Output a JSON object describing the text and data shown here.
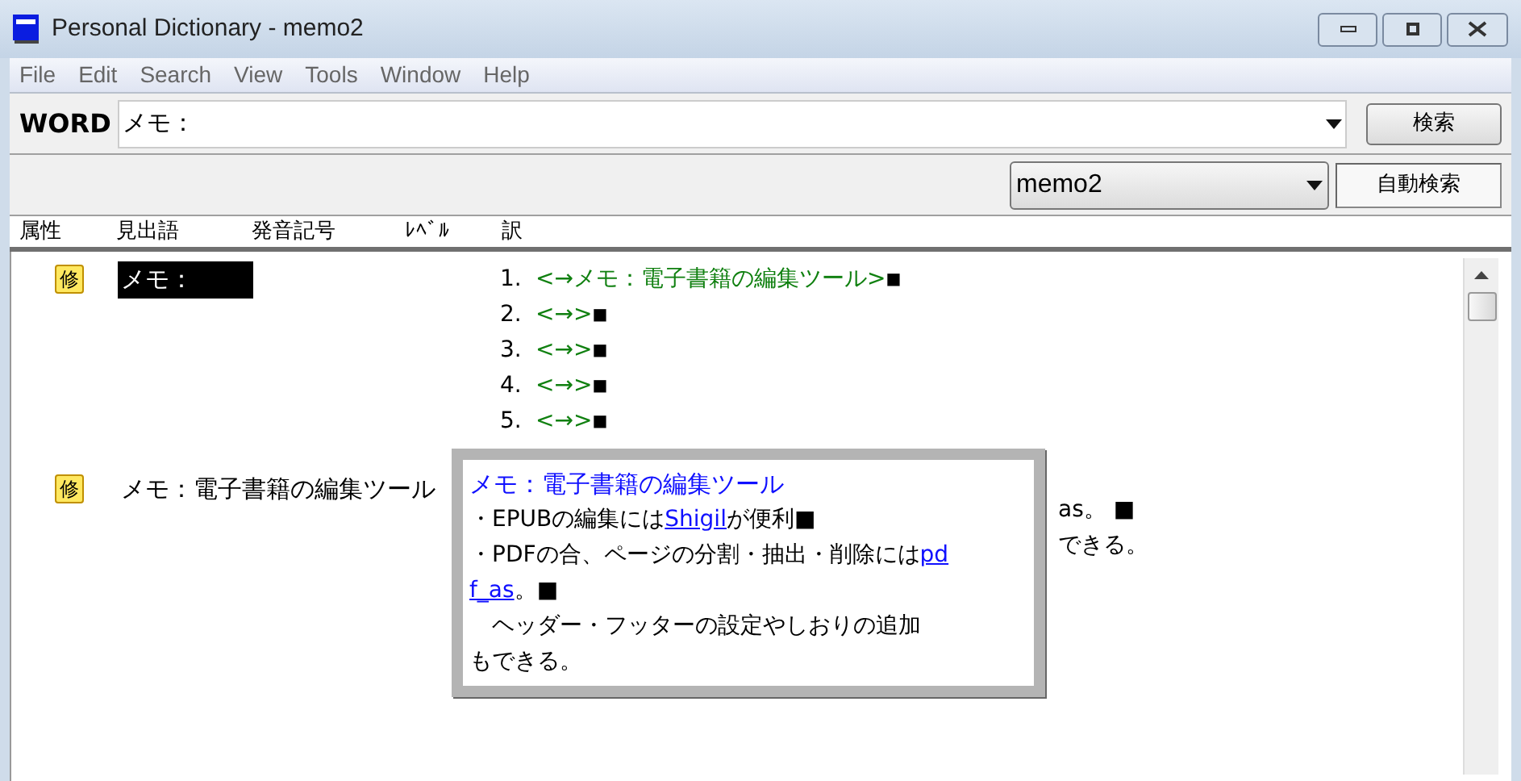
{
  "window": {
    "title": "Personal Dictionary - memo2"
  },
  "menu": [
    "File",
    "Edit",
    "Search",
    "View",
    "Tools",
    "Window",
    "Help"
  ],
  "search": {
    "label": "WORD",
    "value": "メモ：",
    "button": "検索"
  },
  "dictionary": {
    "value": "memo2",
    "button": "自動検索",
    "pressed": false
  },
  "columns": [
    "属性",
    "見出語",
    "発音記号",
    "ﾚﾍﾞﾙ",
    "訳"
  ],
  "entries": [
    {
      "badge": "修",
      "headword": "メモ：",
      "selected": true,
      "senses": [
        {
          "number": "1.",
          "text": "<→メモ：電子書籍の編集ツール>",
          "end": "■"
        },
        {
          "number": "2.",
          "text": "<→>",
          "end": "■"
        },
        {
          "number": "3.",
          "text": "<→>",
          "end": "■"
        },
        {
          "number": "4.",
          "text": "<→>",
          "end": "■"
        },
        {
          "number": "5.",
          "text": "<→>",
          "end": "■"
        }
      ]
    },
    {
      "badge": "修",
      "headword": "メモ：電子書籍の編集ツール",
      "selected": false,
      "fragments": [
        "as。 ■",
        "できる。"
      ]
    }
  ],
  "popup": {
    "title": "メモ：電子書籍の編集ツール",
    "lines": [
      {
        "kind": "text",
        "parts": [
          {
            "text": "・EPUBの編集には"
          },
          {
            "text": "Shigil",
            "link": true
          },
          {
            "text": "が便利■"
          }
        ]
      },
      {
        "kind": "text",
        "parts": [
          {
            "text": "・PDFの合、ページの分割・抽出・削除には"
          },
          {
            "text": "pd",
            "link": true
          }
        ]
      },
      {
        "kind": "text",
        "parts": [
          {
            "text": "f_as",
            "link": true
          },
          {
            "text": "。■"
          }
        ]
      },
      {
        "kind": "text",
        "parts": [
          {
            "text": "　ヘッダー・フッターの設定やしおりの追加"
          }
        ]
      },
      {
        "kind": "text",
        "parts": [
          {
            "text": "もできる。"
          }
        ]
      }
    ]
  }
}
